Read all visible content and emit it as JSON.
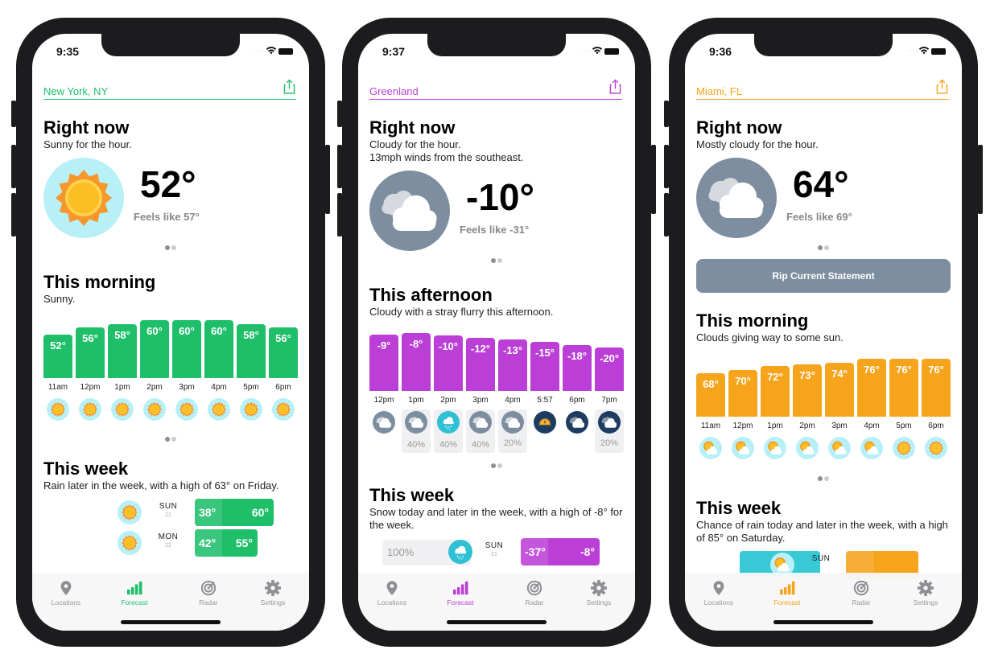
{
  "colors": {
    "ny_accent": "#1fbf6a",
    "gl_accent": "#bb3fd6",
    "mi_accent": "#f7a41d",
    "sun_bg": "#b8f0f7",
    "cloud_bg": "#7d8ea0",
    "night_bg": "#1d3d60",
    "snow_bg": "#2fc0d6"
  },
  "tabs": [
    "Locations",
    "Forecast",
    "Radar",
    "Settings"
  ],
  "phones": [
    {
      "time": "9:35",
      "location": "New York, NY",
      "now": {
        "title": "Right now",
        "summary": "Sunny for the hour.",
        "summary2": "",
        "temp": "52°",
        "feels": "Feels like 57°",
        "icon": "sun-icon"
      },
      "hourly": {
        "title": "This morning",
        "summary": "Sunny.",
        "temps": [
          52,
          56,
          58,
          60,
          60,
          60,
          58,
          56
        ],
        "labels": [
          "52°",
          "56°",
          "58°",
          "60°",
          "60°",
          "60°",
          "58°",
          "56°"
        ],
        "hours": [
          "11am",
          "12pm",
          "1pm",
          "2pm",
          "3pm",
          "4pm",
          "5pm",
          "6pm"
        ],
        "icons": [
          "sun-icon",
          "sun-icon",
          "sun-icon",
          "sun-icon",
          "sun-icon",
          "sun-icon",
          "sun-icon",
          "sun-icon"
        ],
        "precip": [
          "",
          "",
          "",
          "",
          "",
          "",
          "",
          ""
        ]
      },
      "week": {
        "title": "This week",
        "summary": "Rain later in the week, with a high of 63° on Friday.",
        "days": [
          {
            "day": "SUN",
            "date": "21",
            "low": "38°",
            "high": "60°",
            "icon": "sun-icon"
          },
          {
            "day": "MON",
            "date": "22",
            "low": "42°",
            "high": "55°",
            "icon": "sun-icon"
          }
        ]
      }
    },
    {
      "time": "9:37",
      "location": "Greenland",
      "now": {
        "title": "Right now",
        "summary": "Cloudy for the hour.",
        "summary2": "13mph winds from the southeast.",
        "temp": "-10°",
        "feels": "Feels like -31°",
        "icon": "cloud-icon"
      },
      "hourly": {
        "title": "This afternoon",
        "summary": "Cloudy with a stray flurry this afternoon.",
        "temps": [
          -9,
          -8,
          -10,
          -12,
          -13,
          -15,
          -18,
          -20
        ],
        "labels": [
          "-9°",
          "-8°",
          "-10°",
          "-12°",
          "-13°",
          "-15°",
          "-18°",
          "-20°"
        ],
        "hours": [
          "12pm",
          "1pm",
          "2pm",
          "3pm",
          "4pm",
          "5:57",
          "6pm",
          "7pm"
        ],
        "icons": [
          "cloud-icon",
          "cloud-icon",
          "snow-icon",
          "cloud-icon",
          "cloud-icon",
          "sunset-icon",
          "night-cloud-icon",
          "night-cloud-icon"
        ],
        "precip": [
          "",
          "40%",
          "40%",
          "40%",
          "20%",
          "",
          "",
          "20%"
        ]
      },
      "week": {
        "title": "This week",
        "summary": "Snow today and later in the week, with a high of -8° for the week.",
        "days": [
          {
            "day": "SUN",
            "date": "21",
            "low": "-37°",
            "high": "-8°",
            "icon": "snow-icon",
            "precip": "100%"
          }
        ]
      }
    },
    {
      "time": "9:36",
      "location": "Miami, FL",
      "now": {
        "title": "Right now",
        "summary": "Mostly cloudy for the hour.",
        "summary2": "",
        "temp": "64°",
        "feels": "Feels like 69°",
        "icon": "cloud-icon"
      },
      "alert": "Rip Current Statement",
      "hourly": {
        "title": "This morning",
        "summary": "Clouds giving way to some sun.",
        "temps": [
          68,
          70,
          72,
          73,
          74,
          76,
          76,
          76
        ],
        "labels": [
          "68°",
          "70°",
          "72°",
          "73°",
          "74°",
          "76°",
          "76°",
          "76°"
        ],
        "hours": [
          "11am",
          "12pm",
          "1pm",
          "2pm",
          "3pm",
          "4pm",
          "5pm",
          "6pm"
        ],
        "icons": [
          "partly-cloudy-icon",
          "partly-cloudy-icon",
          "partly-cloudy-icon",
          "partly-cloudy-icon",
          "partly-cloudy-icon",
          "partly-cloudy-icon",
          "sun-icon",
          "sun-icon"
        ],
        "precip": [
          "",
          "",
          "",
          "",
          "",
          "",
          "",
          ""
        ]
      },
      "week": {
        "title": "This week",
        "summary": "Chance of rain today and later in the week, with a high of 85° on Saturday.",
        "days": [
          {
            "day": "SUN",
            "date": "",
            "low": "",
            "high": "",
            "icon": "partly-cloudy-icon"
          }
        ]
      }
    }
  ]
}
